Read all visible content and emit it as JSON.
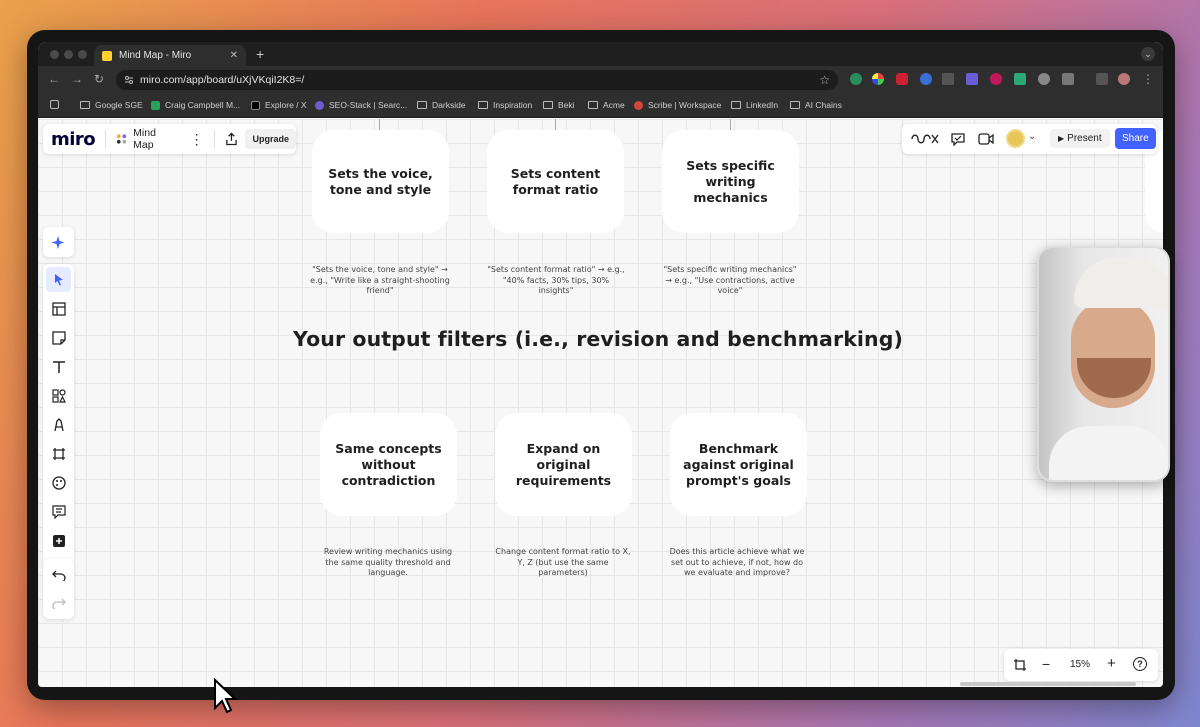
{
  "browser": {
    "tab_title": "Mind Map - Miro",
    "new_tab": "+",
    "url": "miro.com/app/board/uXjVKqiI2K8=/",
    "bookmarks": [
      "Google SGE",
      "Craig Campbell M...",
      "Explore / X",
      "SEO-Stack | Searc...",
      "Darkside",
      "Inspiration",
      "Beki",
      "Acme",
      "Scribe | Workspace",
      "LinkedIn",
      "AI Chains"
    ]
  },
  "miro": {
    "logo": "miro",
    "board_name": "Mind Map",
    "upgrade_label": "Upgrade",
    "present_label": "Present",
    "share_label": "Share",
    "zoom_level": "15%"
  },
  "board": {
    "top_cards": [
      {
        "title": "Sets the voice, tone and style",
        "desc": "\"Sets the voice, tone and style\" → e.g., \"Write like a straight-shooting friend\""
      },
      {
        "title": "Sets content format ratio",
        "desc": "\"Sets content format ratio\" → e.g., \"40% facts, 30% tips, 30% insights\""
      },
      {
        "title": "Sets specific writing mechanics",
        "desc": "\"Sets specific writing mechanics\" → e.g., \"Use contractions, active voice\""
      }
    ],
    "section_heading": "Your output filters (i.e., revision and benchmarking)",
    "bottom_cards": [
      {
        "title": "Same concepts without contradiction",
        "desc": "Review writing mechanics using the same quality threshold and language."
      },
      {
        "title": "Expand on original requirements",
        "desc": "Change content format ratio to X, Y, Z (but use the same parameters)"
      },
      {
        "title": "Benchmark against original prompt's goals",
        "desc": "Does this article achieve what we set out to achieve, if not, how do we evaluate and improve?"
      }
    ]
  },
  "colors": {
    "share_button": "#4262ff",
    "miro_yellow": "#ffd02f",
    "canvas_bg": "#f7f7f7"
  }
}
